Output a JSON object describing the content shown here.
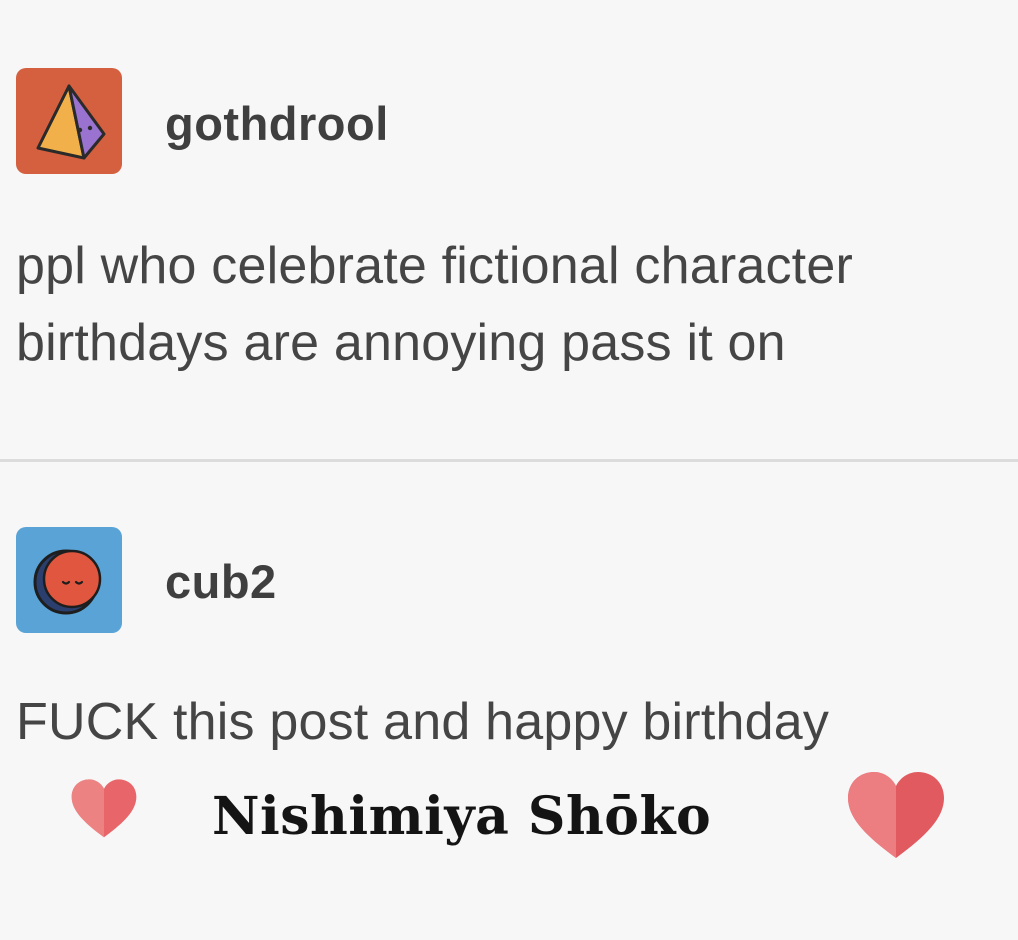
{
  "posts": [
    {
      "username": "gothdrool",
      "avatar_icon": "pyramid-icon",
      "avatar_color": "#d4603f",
      "text": "ppl who celebrate fictional character birthdays are annoying pass it on"
    },
    {
      "username": "cub2",
      "avatar_icon": "moon-face-icon",
      "avatar_color": "#5aa3d6",
      "text": "FUCK this post and happy birthday"
    }
  ],
  "caption": {
    "text": "Nishimiya Shōko",
    "heart_icon": "heart-icon",
    "heart_color": "#e8666a"
  }
}
